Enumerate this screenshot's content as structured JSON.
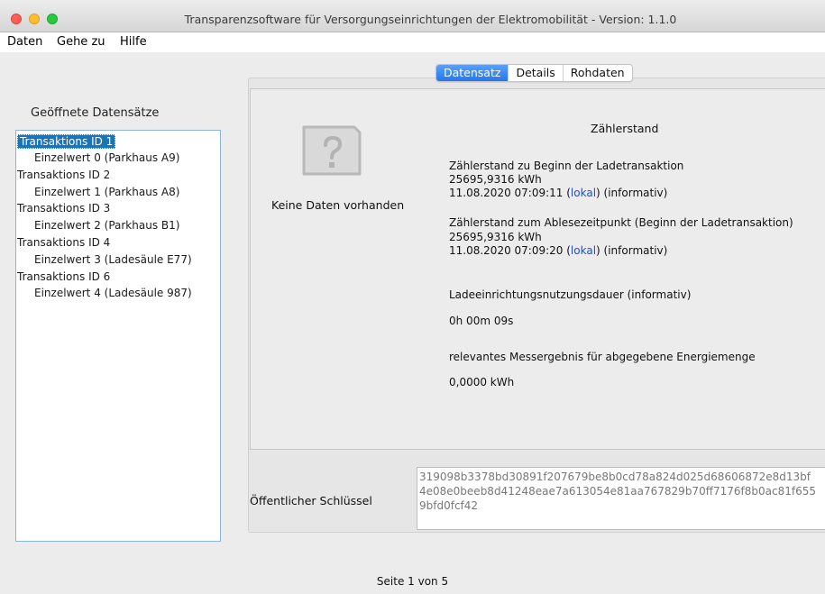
{
  "window": {
    "title": "Transparenzsoftware für Versorgungseinrichtungen der Elektromobilität - Version: 1.1.0"
  },
  "menu": {
    "items": [
      "Daten",
      "Gehe zu",
      "Hilfe"
    ]
  },
  "sidebar": {
    "label": "Geöffnete Datensätze",
    "tree": [
      {
        "label": "Transaktions ID 1",
        "level": "parent",
        "selected": true
      },
      {
        "label": "Einzelwert 0 (Parkhaus A9)",
        "level": "child"
      },
      {
        "label": "Transaktions ID 2",
        "level": "parent"
      },
      {
        "label": "Einzelwert 1 (Parkhaus A8)",
        "level": "child"
      },
      {
        "label": "Transaktions ID 3",
        "level": "parent"
      },
      {
        "label": "Einzelwert 2 (Parkhaus B1)",
        "level": "child"
      },
      {
        "label": "Transaktions ID 4",
        "level": "parent"
      },
      {
        "label": "Einzelwert 3 (Ladesäule E77)",
        "level": "child"
      },
      {
        "label": "Transaktions ID 6",
        "level": "parent"
      },
      {
        "label": "Einzelwert 4 (Ladesäule 987)",
        "level": "child"
      }
    ]
  },
  "tabs": [
    {
      "label": "Datensatz",
      "active": true
    },
    {
      "label": "Details",
      "active": false
    },
    {
      "label": "Rohdaten",
      "active": false
    }
  ],
  "content": {
    "placeholder_icon": "question-document-icon",
    "no_data": "Keine Daten vorhanden",
    "heading": "Zählerstand",
    "start_label": "Zählerstand zu Beginn der Ladetransaktion",
    "start_value": "25695,9316 kWh",
    "start_time": "11.08.2020 07:09:11",
    "start_tz": "lokal",
    "start_note": "(informativ)",
    "read_label": "Zählerstand zum Ablesezeitpunkt (Beginn der Ladetransaktion)",
    "read_value": "25695,9316 kWh",
    "read_time": "11.08.2020 07:09:20",
    "read_tz": "lokal",
    "read_note": "(informativ)",
    "duration_label": "Ladeeinrichtungsnutzungsdauer (informativ)",
    "duration_value": "0h 00m 09s",
    "energy_label": "relevantes Messergebnis für abgegebene Energiemenge",
    "energy_value": "0,0000 kWh"
  },
  "public_key": {
    "label": "Öffentlicher Schlüssel",
    "lines": [
      "319098b3378bd30891f207679be8b0cd78a824d025d68606872e8d13bf",
      "4e08e0beeb8d41248eae7a613054e81aa767829b70ff7176f8b0ac81f655",
      "9bfd0fcf42"
    ]
  },
  "footer": {
    "page_info": "Seite 1 von 5"
  },
  "colors": {
    "tab_active": "#2576ef",
    "selection": "#1b73b8",
    "link": "#1a4fd6"
  }
}
